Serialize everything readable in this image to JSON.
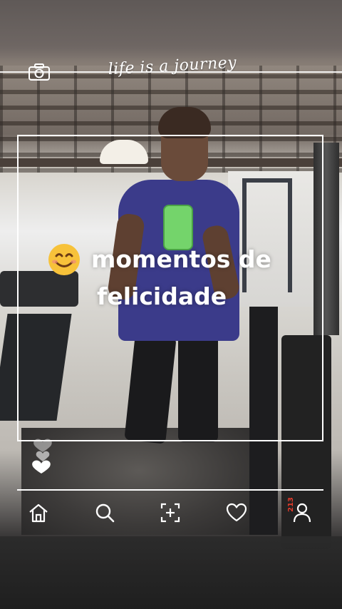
{
  "overlay": {
    "handwriting": "life is a journey",
    "caption": {
      "line1": "momentos de",
      "line2": "felicidade"
    },
    "badge_count": "213"
  },
  "icons": {
    "camera": "camera-icon",
    "emoji": "smiling-face-emoji",
    "hearts": "heart-icon",
    "toolbar": [
      "home-icon",
      "search-icon",
      "scan-icon",
      "heart-icon",
      "user-icon"
    ]
  },
  "colors": {
    "overlay_line": "#ffffff",
    "badge": "#e33b2b",
    "emoji_face": "#f7c23a",
    "phone_case": "#74d46b",
    "shirt": "#3b3b8a"
  }
}
